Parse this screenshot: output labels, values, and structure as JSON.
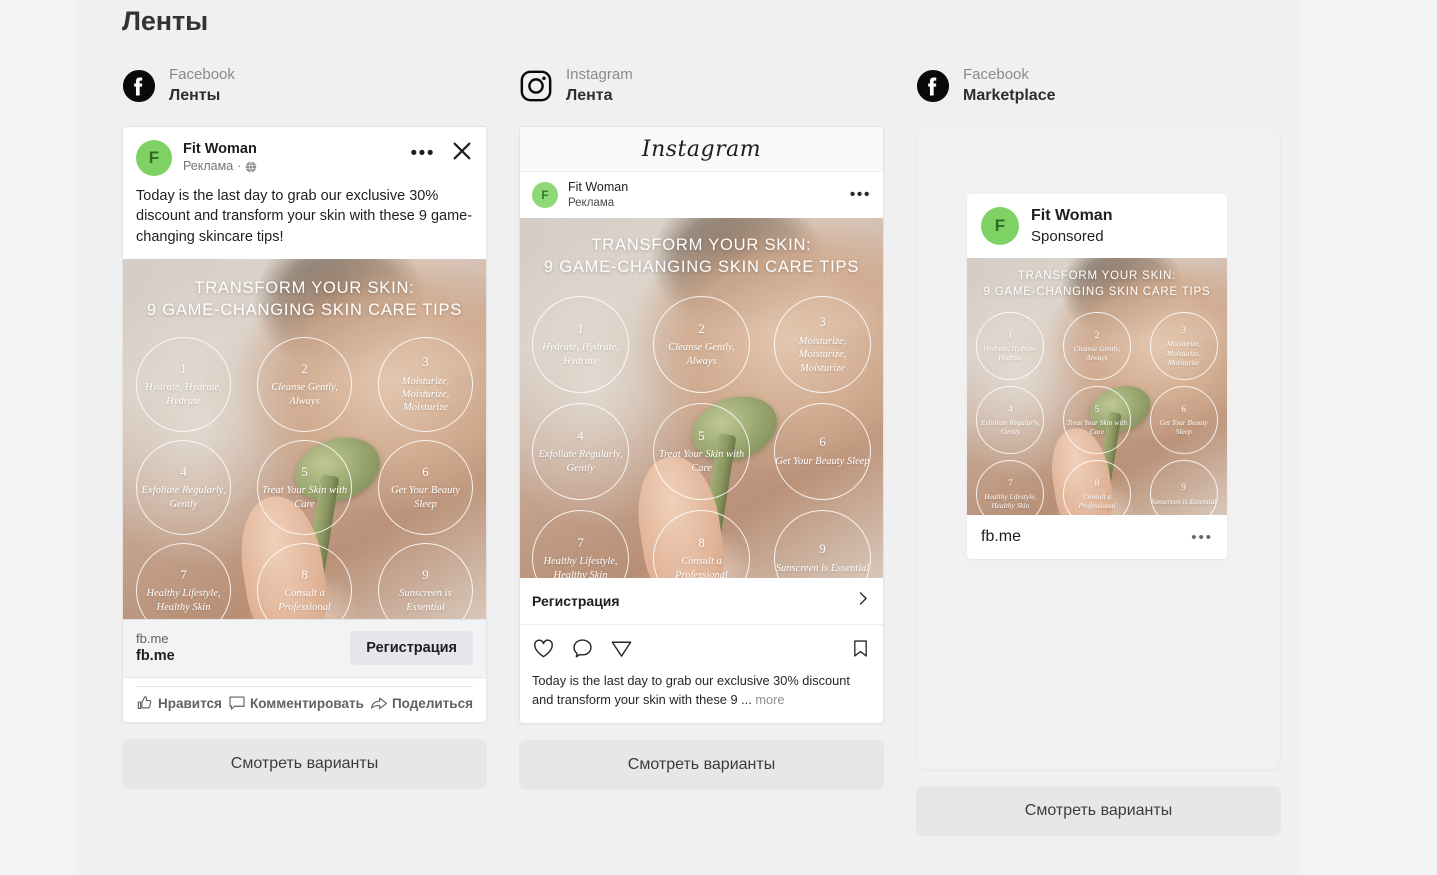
{
  "page": {
    "title": "Ленты"
  },
  "platforms": [
    {
      "sub": "Facebook",
      "name": "Ленты",
      "icon": "facebook-icon"
    },
    {
      "sub": "Instagram",
      "name": "Лента",
      "icon": "instagram-icon"
    },
    {
      "sub": "Facebook",
      "name": "Marketplace",
      "icon": "facebook-icon"
    }
  ],
  "ad": {
    "brand": "Fit Woman",
    "avatar_initial": "F",
    "sponsored_ru": "Реклама",
    "sponsored_en": "Sponsored",
    "primary_text": "Today is the last day to grab our exclusive 30% discount and transform your skin with these 9 game-changing skincare tips!",
    "caption_short": "Today is the last day to grab our exclusive 30% discount and transform your skin with these 9 ...",
    "more_label": "more",
    "display_link": "fb.me",
    "link_title": "fb.me",
    "cta": "Регистрация",
    "image": {
      "title_line1": "TRANSFORM YOUR SKIN:",
      "title_line2": "9 GAME-CHANGING SKIN CARE TIPS",
      "tips": [
        {
          "num": "1",
          "text": "Hydrate, Hydrate, Hydrate"
        },
        {
          "num": "2",
          "text": "Cleanse Gently, Always"
        },
        {
          "num": "3",
          "text": "Moisturize, Moisturize, Moisturize"
        },
        {
          "num": "4",
          "text": "Exfoliate Regularly, Gently"
        },
        {
          "num": "5",
          "text": "Treat Your Skin with Care"
        },
        {
          "num": "6",
          "text": "Get Your Beauty Sleep"
        },
        {
          "num": "7",
          "text": "Healthy Lifestyle, Healthy Skin"
        },
        {
          "num": "8",
          "text": "Consult a Professional"
        },
        {
          "num": "9",
          "text": "Sunscreen is Essential"
        }
      ]
    }
  },
  "facebook_actions": {
    "like": "Нравится",
    "comment": "Комментировать",
    "share": "Поделиться"
  },
  "instagram": {
    "wordmark": "Instagram",
    "cta": "Регистрация"
  },
  "variants_button": "Смотреть варианты",
  "colors": {
    "page_bg": "#f0f0f0",
    "rail_bg": "#f4f4f4",
    "card_bg": "#ffffff",
    "avatar_green": "#7ed163",
    "cta_bg": "#e4e6eb",
    "variants_bg": "#e7e7e7",
    "muted_text": "#8b8b8b"
  }
}
